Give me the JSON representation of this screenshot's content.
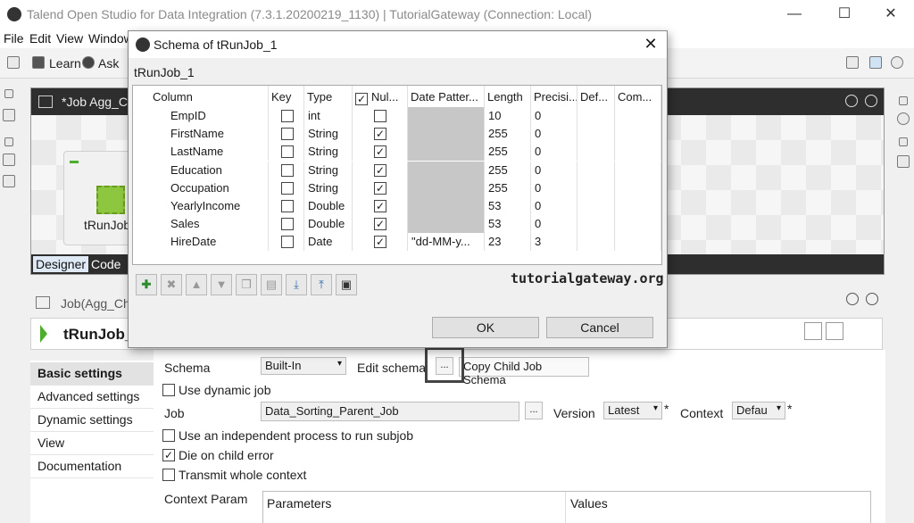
{
  "window": {
    "title": "Talend Open Studio for Data Integration (7.3.1.20200219_1130) | TutorialGateway (Connection: Local)",
    "minimize": "—",
    "maximize": "☐",
    "close": "✕"
  },
  "menu": [
    "File",
    "Edit",
    "View",
    "Window"
  ],
  "toolbar": {
    "learn": "Learn",
    "ask": "Ask"
  },
  "job_panel": {
    "tab_title": "*Job Agg_Ch",
    "node_label": "tRunJob",
    "tabs": [
      "Designer",
      "Code"
    ]
  },
  "properties": {
    "header": "Job(Agg_Chi",
    "component_name": "tRunJob_",
    "nav": [
      "Basic settings",
      "Advanced settings",
      "Dynamic settings",
      "View",
      "Documentation"
    ],
    "schema_label": "Schema",
    "schema_value": "Built-In",
    "edit_schema_label": "Edit schema",
    "edit_schema_button": "...",
    "copy_child_button": "Copy Child Job Schema",
    "use_dynamic_job": "Use dynamic job",
    "job_label": "Job",
    "job_value": "Data_Sorting_Parent_Job",
    "job_browse": "...",
    "version_label": "Version",
    "version_value": "Latest",
    "context_label": "Context",
    "context_value": "Defau",
    "required_mark": "*",
    "independent_process": "Use an independent process to run subjob",
    "die_on_child_error": "Die on child error",
    "transmit_whole_context": "Transmit whole context",
    "context_param_label": "Context Param",
    "params_col_parameters": "Parameters",
    "params_col_values": "Values"
  },
  "dialog": {
    "title": "Schema of tRunJob_1",
    "close": "✕",
    "subtitle": "tRunJob_1",
    "columns": [
      "Column",
      "Key",
      "Type",
      "Nul...",
      "Date Patter...",
      "Length",
      "Precisi...",
      "Def...",
      "Com..."
    ],
    "rows": [
      {
        "column": "EmpID",
        "key": false,
        "type": "int",
        "nullable": false,
        "date_pattern": "",
        "length": "10",
        "precision": "0"
      },
      {
        "column": "FirstName",
        "key": false,
        "type": "String",
        "nullable": true,
        "date_pattern": "",
        "length": "255",
        "precision": "0"
      },
      {
        "column": "LastName",
        "key": false,
        "type": "String",
        "nullable": true,
        "date_pattern": "",
        "length": "255",
        "precision": "0"
      },
      {
        "column": "Education",
        "key": false,
        "type": "String",
        "nullable": true,
        "date_pattern": "",
        "length": "255",
        "precision": "0"
      },
      {
        "column": "Occupation",
        "key": false,
        "type": "String",
        "nullable": true,
        "date_pattern": "",
        "length": "255",
        "precision": "0"
      },
      {
        "column": "YearlyIncome",
        "key": false,
        "type": "Double",
        "nullable": true,
        "date_pattern": "",
        "length": "53",
        "precision": "0"
      },
      {
        "column": "Sales",
        "key": false,
        "type": "Double",
        "nullable": true,
        "date_pattern": "",
        "length": "53",
        "precision": "0"
      },
      {
        "column": "HireDate",
        "key": false,
        "type": "Date",
        "nullable": true,
        "date_pattern": "\"dd-MM-y...",
        "length": "23",
        "precision": "3"
      }
    ],
    "watermark": "tutorialgateway.org",
    "ok": "OK",
    "cancel": "Cancel",
    "toolbar_icons": [
      "add-icon",
      "delete-icon",
      "move-up-icon",
      "move-down-icon",
      "copy-icon",
      "paste-icon",
      "import-icon",
      "export-icon",
      "save-icon"
    ]
  },
  "colors": {
    "accent_green": "#4cae2a",
    "dark_header": "#2e2e2e"
  }
}
